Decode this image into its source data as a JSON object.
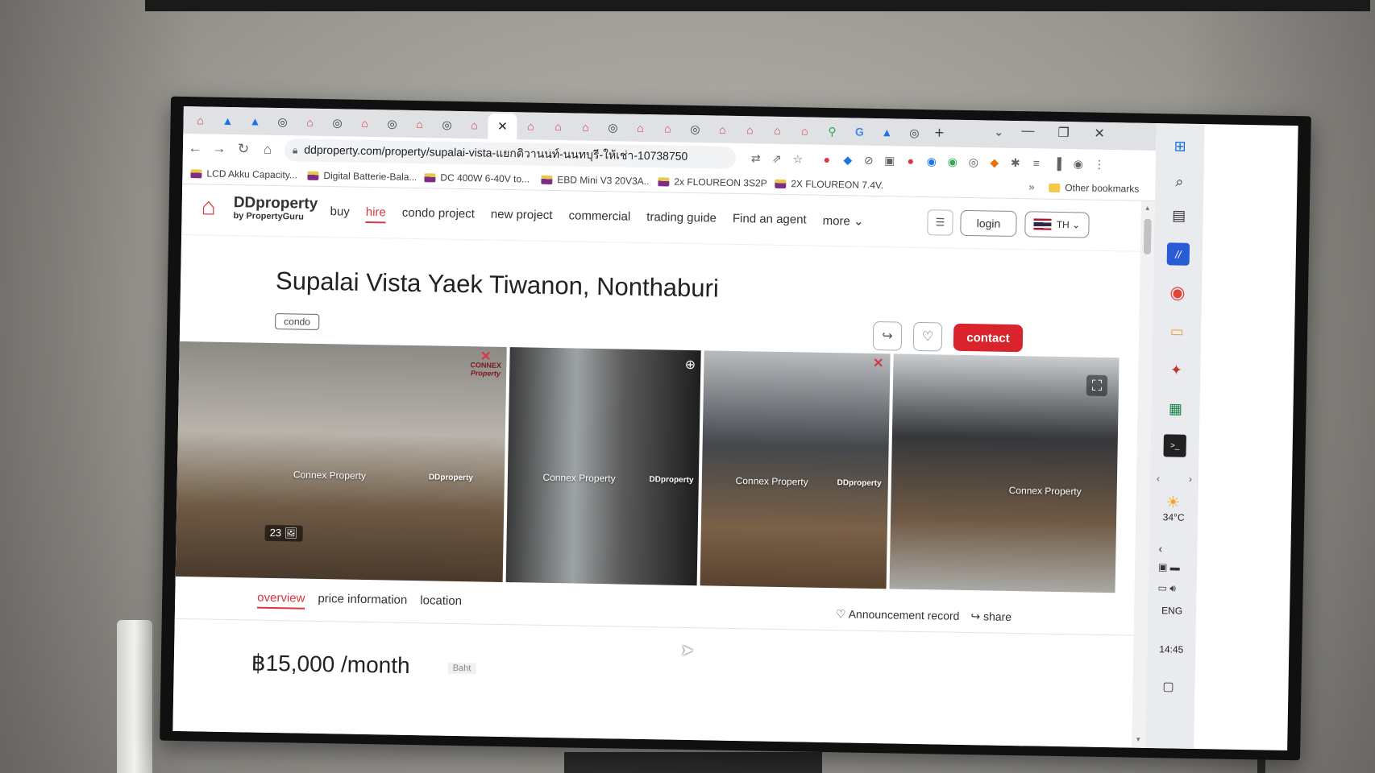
{
  "browser": {
    "tabs": [
      "dd",
      "blue",
      "blue",
      "gray",
      "dd",
      "gray",
      "dd",
      "gray",
      "dd",
      "gray",
      "dd",
      "close",
      "dd",
      "dd",
      "dd",
      "gray",
      "dd",
      "dd",
      "gray",
      "dd",
      "dd",
      "dd",
      "dd",
      "maps",
      "g",
      "blue",
      "gray"
    ],
    "new_tab_label": "+",
    "url": "ddproperty.com/property/supalai-vista-แยกติวานนท์-นนทบุรี-ให้เช่า-10738750",
    "bookmarks": [
      {
        "label": "LCD Akku Capacity..."
      },
      {
        "label": "Digital Batterie-Bala..."
      },
      {
        "label": "DC 400W 6-40V to..."
      },
      {
        "label": "EBD Mini V3 20V3A..."
      },
      {
        "label": "2x FLOUREON 3S2P..."
      },
      {
        "label": "2X FLOUREON 7.4V..."
      }
    ],
    "bookmarks_more": "»",
    "other_bookmarks": "Other bookmarks"
  },
  "site": {
    "logo_name": "DDproperty",
    "logo_sub": "by PropertyGuru",
    "nav": [
      "buy",
      "hire",
      "condo project",
      "new project",
      "commercial",
      "trading guide",
      "Find an agent",
      "more ⌄"
    ],
    "nav_active": "hire",
    "login_label": "login",
    "lang_label": "TH ⌄"
  },
  "listing": {
    "title": "Supalai Vista Yaek Tiwanon, Nonthaburi",
    "type": "condo",
    "contact_label": "contact",
    "photo_count": "23",
    "watermark_agent": "Connex Property",
    "watermark_site": "DDproperty",
    "connex_brand": "CONNEX",
    "connex_sub": "Property",
    "subtabs": [
      "overview",
      "price information",
      "location"
    ],
    "subtab_active": "overview",
    "announcement_label": "Announcement record",
    "share_label": "share",
    "price": "฿15,000 /month",
    "price_unit": "Baht"
  },
  "taskbar": {
    "temperature": "34°C",
    "language": "ENG",
    "time": "14:45"
  },
  "colors": {
    "brand_red": "#d9363e",
    "contact_red": "#d9232d"
  }
}
